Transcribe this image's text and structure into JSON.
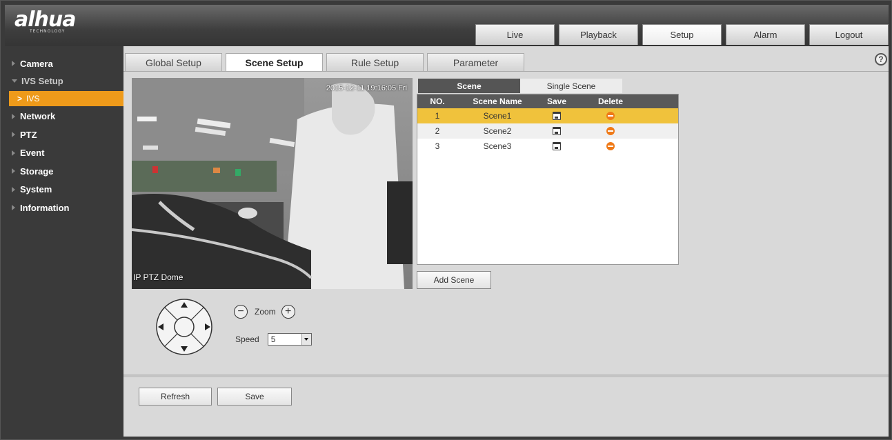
{
  "brand": {
    "logo": "alhua",
    "sub": "TECHNOLOGY"
  },
  "top_tabs": [
    {
      "label": "Live",
      "active": false
    },
    {
      "label": "Playback",
      "active": false
    },
    {
      "label": "Setup",
      "active": true
    },
    {
      "label": "Alarm",
      "active": false
    },
    {
      "label": "Logout",
      "active": false
    }
  ],
  "sidebar": {
    "items": [
      {
        "label": "Camera"
      },
      {
        "label": "IVS Setup"
      },
      {
        "label": "IVS"
      },
      {
        "label": "Network"
      },
      {
        "label": "PTZ"
      },
      {
        "label": "Event"
      },
      {
        "label": "Storage"
      },
      {
        "label": "System"
      },
      {
        "label": "Information"
      }
    ]
  },
  "sub_tabs": [
    {
      "label": "Global Setup"
    },
    {
      "label": "Scene Setup"
    },
    {
      "label": "Rule Setup"
    },
    {
      "label": "Parameter"
    }
  ],
  "help_label": "?",
  "video": {
    "timestamp": "2015-12-11 19:16:05 Fri",
    "label": "IP PTZ Dome"
  },
  "scene_tabs": [
    {
      "label": "Scene"
    },
    {
      "label": "Single Scene"
    }
  ],
  "scene_table": {
    "headers": {
      "no": "NO.",
      "name": "Scene Name",
      "save": "Save",
      "delete": "Delete"
    },
    "rows": [
      {
        "no": "1",
        "name": "Scene1"
      },
      {
        "no": "2",
        "name": "Scene2"
      },
      {
        "no": "3",
        "name": "Scene3"
      }
    ]
  },
  "add_scene_label": "Add Scene",
  "ptz": {
    "zoom_label": "Zoom",
    "zoom_minus": "−",
    "zoom_plus": "+",
    "speed_label": "Speed",
    "speed_value": "5"
  },
  "footer": {
    "refresh_label": "Refresh",
    "save_label": "Save"
  },
  "colors": {
    "accent": "#ee9a1a",
    "selected_row": "#f0c23c",
    "delete": "#ef7a18"
  }
}
